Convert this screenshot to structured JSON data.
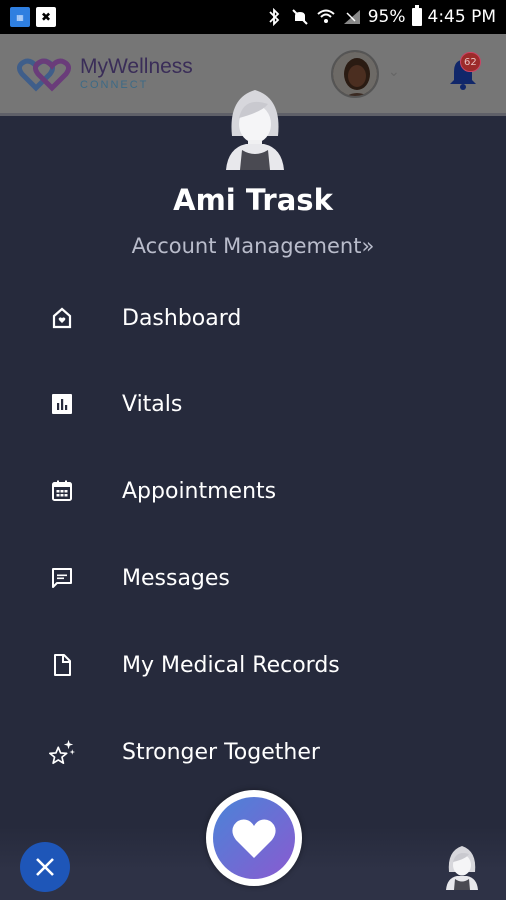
{
  "status_bar": {
    "battery": "95%",
    "time": "4:45 PM"
  },
  "header": {
    "logo_main": "MyWellness",
    "logo_sub": "CONNECT",
    "notification_count": "62"
  },
  "drawer": {
    "user_name": "Ami Trask",
    "account_link": "Account Management»",
    "items": [
      {
        "label": "Dashboard",
        "icon": "home-icon"
      },
      {
        "label": "Vitals",
        "icon": "chart-icon"
      },
      {
        "label": "Appointments",
        "icon": "calendar-icon"
      },
      {
        "label": "Messages",
        "icon": "message-icon"
      },
      {
        "label": "My Medical Records",
        "icon": "document-icon"
      },
      {
        "label": "Stronger Together",
        "icon": "stars-icon"
      }
    ]
  },
  "colors": {
    "drawer_bg": "#262a3c",
    "accent_blue": "#1e56b8",
    "badge_red": "#9c2a2a"
  }
}
